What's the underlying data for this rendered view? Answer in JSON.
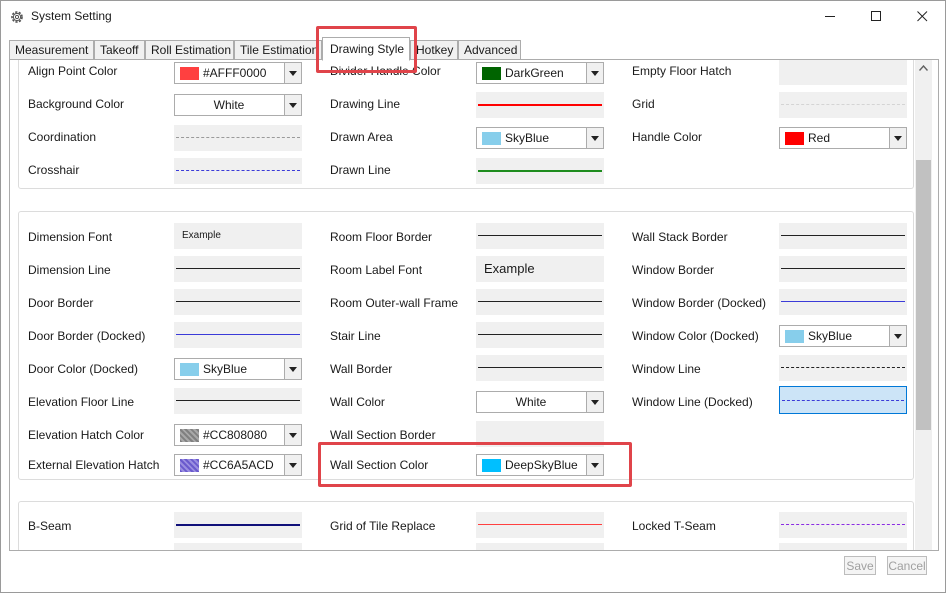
{
  "window": {
    "title": "System Setting"
  },
  "tabs": [
    "Measurement",
    "Takeoff",
    "Roll Estimation",
    "Tile Estimation",
    "Drawing Style",
    "Hotkey",
    "Advanced"
  ],
  "g1": {
    "align_point_color": "Align Point Color",
    "align_point_value": "#AFFF0000",
    "divider_handle_color": "Divider Handle Color",
    "divider_value": "DarkGreen",
    "empty_floor_hatch": "Empty Floor Hatch",
    "background_color": "Background Color",
    "background_value": "White",
    "drawing_line": "Drawing Line",
    "grid": "Grid",
    "coordination": "Coordination",
    "drawn_area": "Drawn Area",
    "drawn_area_value": "SkyBlue",
    "handle_color": "Handle Color",
    "handle_value": "Red",
    "crosshair": "Crosshair",
    "drawn_line": "Drawn Line"
  },
  "g2": {
    "dimension_font": "Dimension Font",
    "dimension_font_example": "Example",
    "room_floor_border": "Room Floor Border",
    "wall_stack_border": "Wall Stack Border",
    "dimension_line": "Dimension Line",
    "room_label_font": "Room Label Font",
    "room_label_example": "Example",
    "window_border": "Window Border",
    "door_border": "Door Border",
    "room_outer_wall_frame": "Room Outer-wall Frame",
    "window_border_docked": "Window Border (Docked)",
    "door_border_docked": "Door Border (Docked)",
    "stair_line": "Stair Line",
    "window_color_docked": "Window Color (Docked)",
    "window_color_value": "SkyBlue",
    "door_color_docked": "Door Color (Docked)",
    "door_color_value": "SkyBlue",
    "wall_border": "Wall Border",
    "window_line": "Window Line",
    "elevation_floor_line": "Elevation Floor Line",
    "wall_color": "Wall Color",
    "wall_color_value": "White",
    "window_line_docked": "Window Line (Docked)",
    "elevation_hatch_color": "Elevation Hatch Color",
    "elevation_hatch_value": "#CC808080",
    "wall_section_border": "Wall Section Border",
    "external_elevation_hatch": "External Elevation Hatch",
    "external_hatch_value": "#CC6A5ACD",
    "wall_section_color": "Wall Section Color",
    "wall_section_value": "DeepSkyBlue"
  },
  "g3": {
    "b_seam": "B-Seam",
    "grid_of_tile_replace": "Grid of Tile Replace",
    "locked_t_seam": "Locked T-Seam"
  },
  "footer": {
    "save": "Save",
    "cancel": "Cancel"
  },
  "colors": {
    "red": "#ff0000",
    "darkgreen": "#006400",
    "skyblue": "#87ceeb",
    "deepskyblue": "#00bfff",
    "gray": "#808080",
    "slateblue": "#6a5acd",
    "highlight": "#e0444a",
    "blue": "#3b3bd8"
  }
}
